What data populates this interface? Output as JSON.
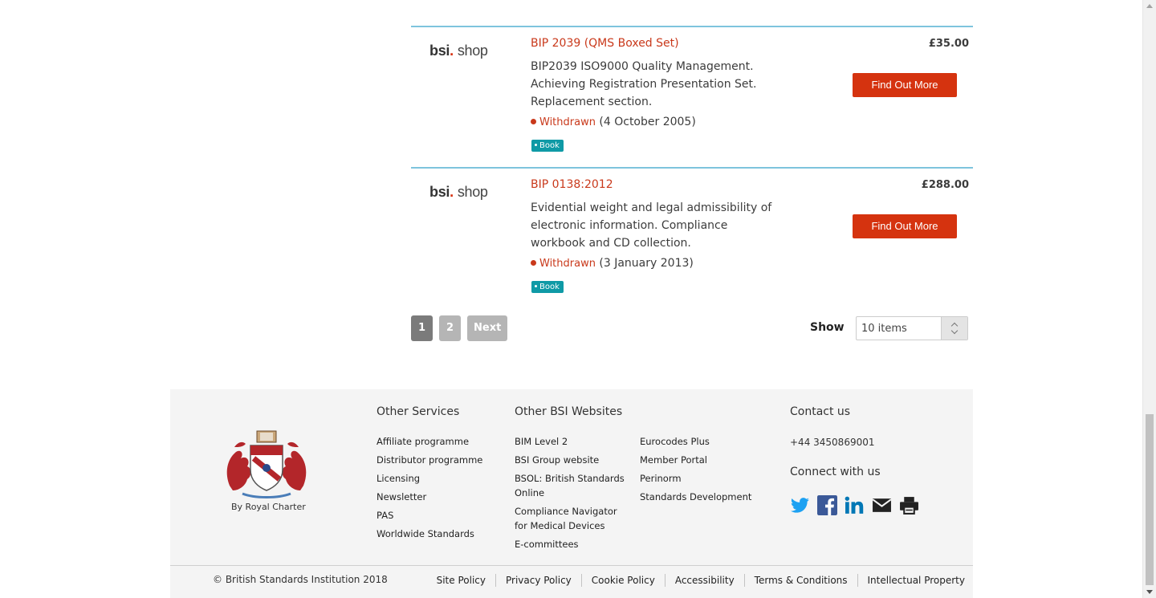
{
  "products": [
    {
      "logo_main": "bsi",
      "logo_dot": ".",
      "logo_shop": "shop",
      "title": "BIP 2039 (QMS Boxed Set)",
      "description": "BIP2039 ISO9000 Quality Management. Achieving Registration Presentation Set. Replacement section.",
      "status": "Withdrawn",
      "status_date": "(4 October 2005)",
      "tag": "Book",
      "price": "£35.00",
      "button": "Find Out More"
    },
    {
      "logo_main": "bsi",
      "logo_dot": ".",
      "logo_shop": "shop",
      "title": "BIP 0138:2012",
      "description": "Evidential weight and legal admissibility of electronic information. Compliance workbook and CD collection.",
      "status": "Withdrawn",
      "status_date": "(3 January 2013)",
      "tag": "Book",
      "price": "£288.00",
      "button": "Find Out More"
    }
  ],
  "pagination": {
    "pages": [
      "1",
      "2"
    ],
    "current": "1",
    "next": "Next",
    "show_label": "Show",
    "show_value": "10 items"
  },
  "footer": {
    "royal_label": "By Royal Charter",
    "other_services": {
      "heading": "Other Services",
      "links": [
        "Affiliate programme",
        "Distributor programme",
        "Licensing",
        "Newsletter",
        "PAS",
        "Worldwide Standards"
      ]
    },
    "other_websites": {
      "heading": "Other BSI Websites",
      "links_col1": [
        "BIM Level 2",
        "BSI Group website",
        "BSOL: British Standards Online",
        "Compliance Navigator for Medical Devices",
        "E-committees"
      ],
      "links_col2": [
        "Eurocodes Plus",
        "Member Portal",
        "Perinorm",
        "Standards Development"
      ]
    },
    "contact": {
      "heading": "Contact us",
      "phone": "+44 3450869001",
      "connect_heading": "Connect with us",
      "social_icons": [
        "twitter-icon",
        "facebook-icon",
        "linkedin-icon",
        "email-icon",
        "print-icon"
      ]
    },
    "copyright": "© British Standards Institution 2018",
    "legal_links": [
      "Site Policy",
      "Privacy Policy",
      "Cookie Policy",
      "Accessibility",
      "Terms & Conditions",
      "Intellectual Property"
    ]
  },
  "colors": {
    "accent_red": "#d5330f",
    "link_red": "#c9391b",
    "rule_blue": "#7ec4dd",
    "tag_teal": "#0f9aa6"
  }
}
